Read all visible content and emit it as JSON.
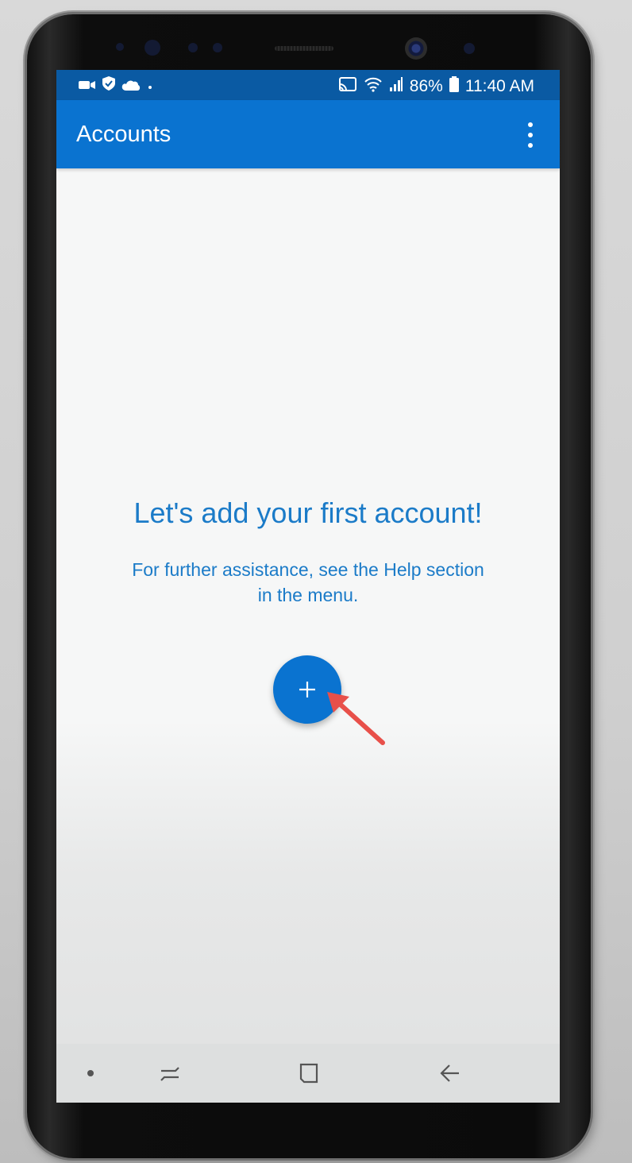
{
  "status_bar": {
    "battery_percent": "86%",
    "time": "11:40 AM",
    "left_icons": [
      "video-camera-icon",
      "shield-icon",
      "cloud-icon",
      "dot-icon"
    ],
    "right_icons": [
      "cast-icon",
      "wifi-icon",
      "signal-icon",
      "battery-icon"
    ]
  },
  "app_bar": {
    "title": "Accounts",
    "menu_icon": "more-vertical-icon"
  },
  "empty_state": {
    "title": "Let's add your first account!",
    "help_line1": "For further assistance, see the Help section",
    "help_line2": "in the menu."
  },
  "fab": {
    "icon": "plus-icon",
    "annotation_arrow": "red-arrow-icon"
  },
  "nav_bar": {
    "icons": [
      "dot-icon",
      "recent-apps-icon",
      "home-icon",
      "back-icon"
    ]
  },
  "colors": {
    "status_bar": "#0a5aa3",
    "app_bar": "#0a73d0",
    "accent_text": "#1b7bc8",
    "annotation_arrow": "#e8504a"
  }
}
